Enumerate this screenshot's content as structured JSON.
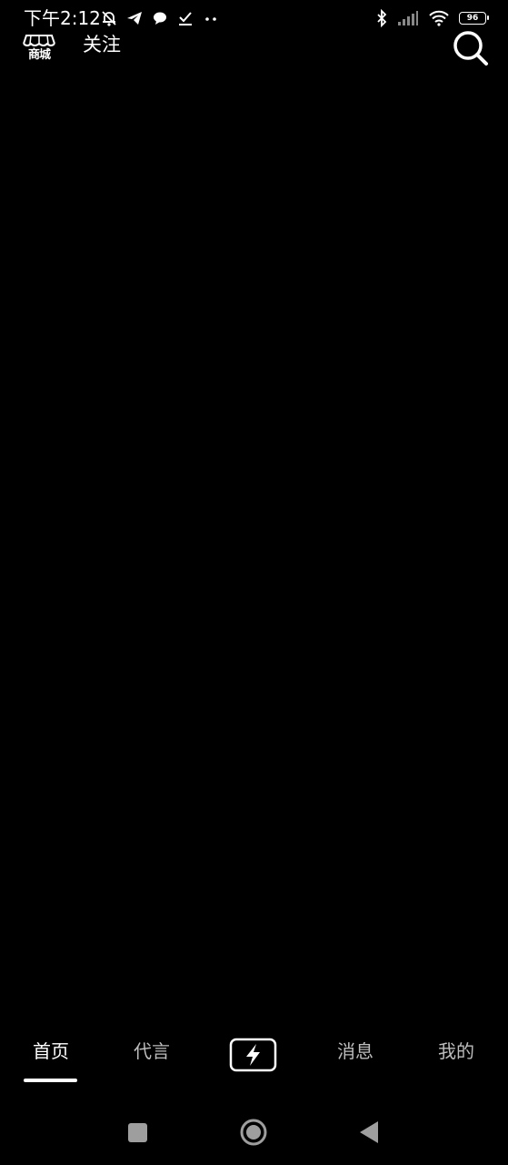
{
  "status_bar": {
    "time": "下午2:12",
    "battery_level": "96",
    "icons_left": [
      "bell-muted-icon",
      "telegram-icon",
      "chat-bubble-icon",
      "download-check-icon",
      "more-dots-icon"
    ],
    "icons_right": [
      "bluetooth-icon",
      "signal-icon",
      "wifi-icon",
      "battery-icon"
    ]
  },
  "top_bar": {
    "shop_label": "商城",
    "follow_label": "关注",
    "search_icon": "search-icon"
  },
  "bottom_nav": {
    "items": [
      {
        "label": "首页",
        "active": true
      },
      {
        "label": "代言",
        "active": false
      },
      {
        "label": "消息",
        "active": false
      },
      {
        "label": "我的",
        "active": false
      }
    ],
    "create_icon": "lightning-icon"
  },
  "system_nav": {
    "buttons": [
      "recent-apps-icon",
      "home-icon",
      "back-icon"
    ]
  },
  "colors": {
    "background": "#000000",
    "text_active": "#ffffff",
    "text_inactive": "#bdbdbd",
    "create_accent_cyan": "#25f4ee",
    "create_accent_pink": "#fe2c55"
  }
}
